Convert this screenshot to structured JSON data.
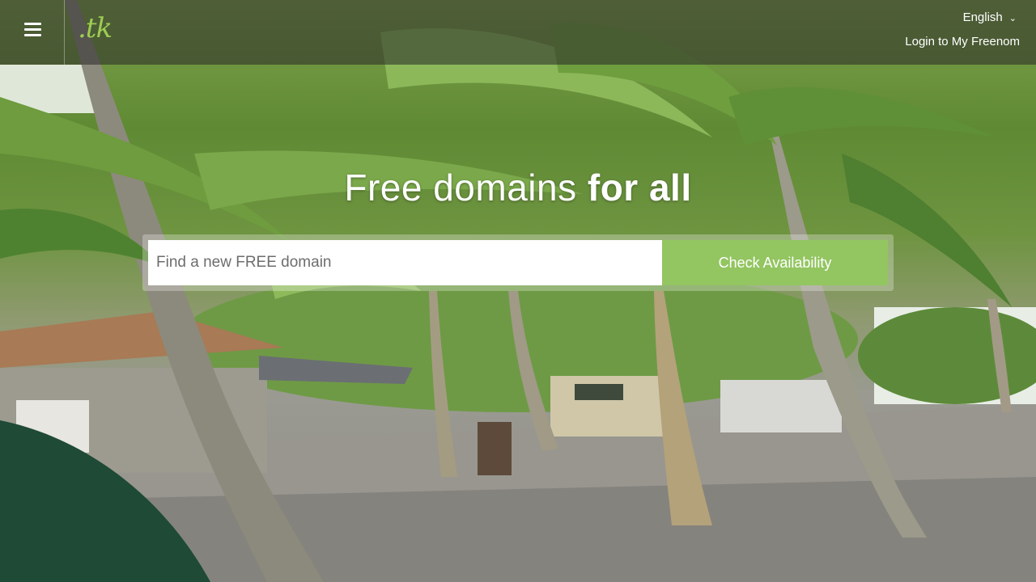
{
  "header": {
    "menu_icon": "hamburger-menu-icon",
    "logo_text": ".tk",
    "language": "English",
    "language_icon": "chevron-down-icon",
    "login_label": "Login to My Freenom"
  },
  "hero": {
    "title_light": "Free domains ",
    "title_bold": "for all",
    "search_placeholder": "Find a new FREE domain",
    "search_value": "",
    "check_button_label": "Check Availability"
  },
  "colors": {
    "accent_green": "#93c561",
    "logo_green": "#9ccc52",
    "header_overlay": "rgba(40,40,40,0.55)"
  }
}
